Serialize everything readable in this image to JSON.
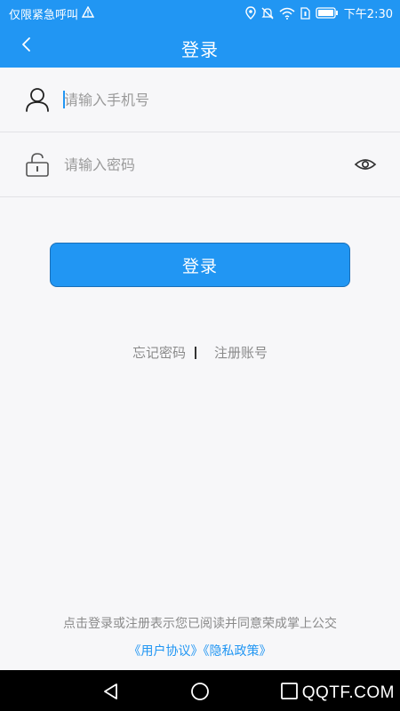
{
  "status_bar": {
    "left_text": "仅限紧急呼叫",
    "time": "下午2:30",
    "icons": [
      "warning-icon",
      "location-icon",
      "mute-icon",
      "wifi-icon",
      "sim-icon",
      "battery-icon"
    ]
  },
  "header": {
    "title": "登录",
    "back_icon": "chevron-left-icon"
  },
  "form": {
    "phone_placeholder": "请输入手机号",
    "phone_value": "",
    "password_placeholder": "请输入密码",
    "password_value": "",
    "phone_icon": "user-icon",
    "password_icon": "lock-icon",
    "visibility_icon": "eye-icon"
  },
  "login_button": {
    "label": "登录"
  },
  "links": {
    "forgot_password": "忘记密码",
    "register": "注册账号"
  },
  "agreement": {
    "text": "点击登录或注册表示您已阅读并同意荣成掌上公交",
    "user_agreement": "《用户协议》",
    "privacy_policy": "《隐私政策》"
  },
  "nav_bar": {
    "icons": [
      "back-triangle-icon",
      "home-circle-icon",
      "recent-square-icon"
    ],
    "watermark": "QQTF.COM"
  },
  "colors": {
    "primary": "#2196f3",
    "background": "#f7f7f9",
    "muted_text": "#8a8a8a",
    "nav_bar": "#000000"
  }
}
